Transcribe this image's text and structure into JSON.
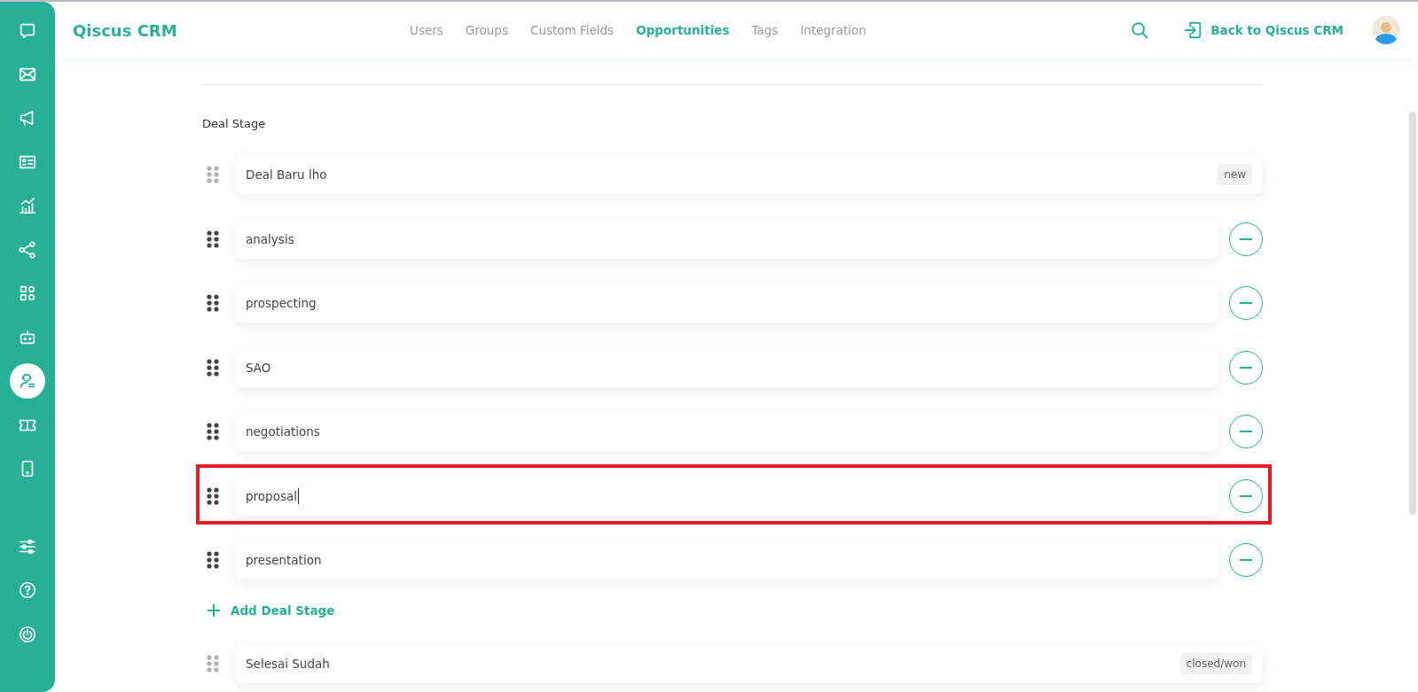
{
  "sidebar": {
    "top_items": [
      {
        "selected": false
      },
      {
        "selected": false
      },
      {
        "selected": false
      },
      {
        "selected": false
      },
      {
        "selected": false
      },
      {
        "selected": false
      },
      {
        "selected": false
      },
      {
        "selected": false
      },
      {
        "selected": true
      },
      {
        "selected": false
      },
      {
        "selected": false
      }
    ],
    "bottom_items": [
      {
        "selected": false
      },
      {
        "selected": false
      },
      {
        "selected": false
      }
    ]
  },
  "header": {
    "logo": "Qiscus CRM",
    "tabs": [
      {
        "label": "Users",
        "selected": false
      },
      {
        "label": "Groups",
        "selected": false
      },
      {
        "label": "Custom Fields",
        "selected": false
      },
      {
        "label": "Opportunities",
        "selected": true
      },
      {
        "label": "Tags",
        "selected": false
      },
      {
        "label": "Integration",
        "selected": false
      }
    ],
    "back_link": "Back to Qiscus CRM"
  },
  "section_title": "Deal Stage",
  "stages": [
    {
      "kind": "fixed",
      "name": "Deal Baru lho",
      "badge": "new",
      "focused": false,
      "highlighted": false
    },
    {
      "kind": "editable",
      "name": "analysis",
      "focused": false,
      "highlighted": false
    },
    {
      "kind": "editable",
      "name": "prospecting",
      "focused": false,
      "highlighted": false
    },
    {
      "kind": "editable",
      "name": "SAO",
      "focused": false,
      "highlighted": false
    },
    {
      "kind": "editable",
      "name": "negotiations",
      "focused": false,
      "highlighted": false
    },
    {
      "kind": "editable",
      "name": "proposal",
      "focused": true,
      "highlighted": true
    },
    {
      "kind": "editable",
      "name": "presentation",
      "focused": false,
      "highlighted": false
    },
    {
      "kind": "add",
      "label": "Add Deal Stage"
    },
    {
      "kind": "fixed",
      "name": "Selesai Sudah",
      "badge": "closed/won",
      "focused": false,
      "highlighted": false
    }
  ]
}
